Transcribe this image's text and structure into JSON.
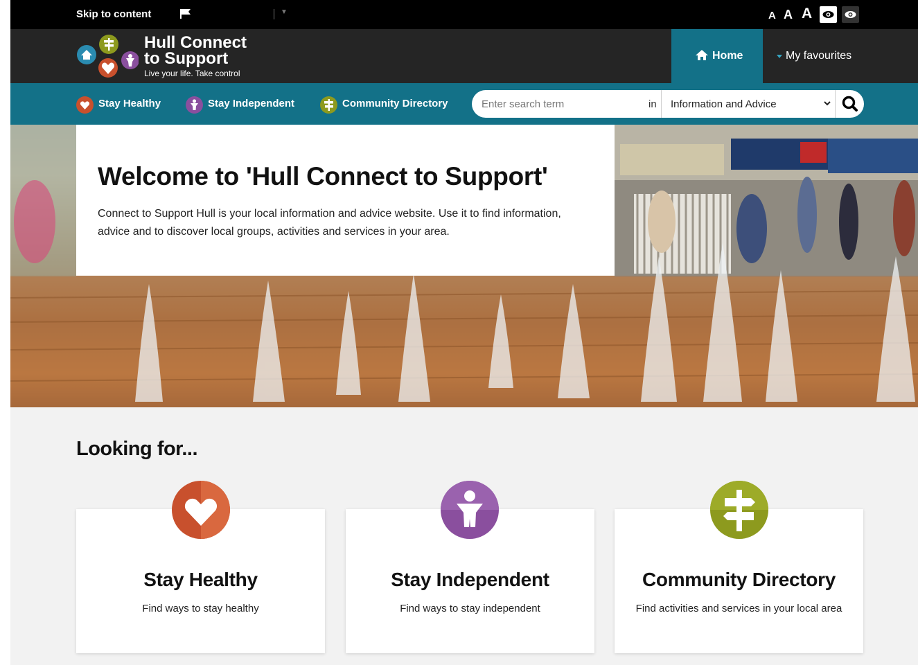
{
  "topbar": {
    "skip_label": "Skip to content",
    "text_size_small": "A",
    "text_size_medium": "A",
    "text_size_large": "A"
  },
  "brand": {
    "name_line1": "Hull Connect",
    "name_line2": "to Support",
    "tagline": "Live your life. Take control"
  },
  "nav": {
    "home_label": "Home",
    "favourites_label": "My favourites"
  },
  "categories": [
    {
      "label": "Stay Healthy",
      "icon": "heart-icon",
      "color": "#c8502d"
    },
    {
      "label": "Stay Independent",
      "icon": "person-icon",
      "color": "#8a4f9e"
    },
    {
      "label": "Community Directory",
      "icon": "signpost-icon",
      "color": "#8d9a1e"
    }
  ],
  "search": {
    "placeholder": "Enter search term",
    "in_label": "in",
    "scope_value": "Information and Advice"
  },
  "hero": {
    "heading": "Welcome to 'Hull Connect to Support'",
    "body": "Connect to Support Hull is your local information and advice website.  Use it to find information, advice and to discover local groups, activities and services in your area."
  },
  "looking_for": {
    "heading": "Looking for...",
    "cards": [
      {
        "title": "Stay Healthy",
        "description": "Find ways to stay healthy"
      },
      {
        "title": "Stay Independent",
        "description": "Find ways to stay independent"
      },
      {
        "title": "Community Directory",
        "description": "Find activities and services in your local area"
      }
    ]
  },
  "colors": {
    "teal": "#137188",
    "header_dark": "#252525",
    "healthy": "#c8502d",
    "independent": "#8a4f9e",
    "community": "#8d9a1e"
  }
}
